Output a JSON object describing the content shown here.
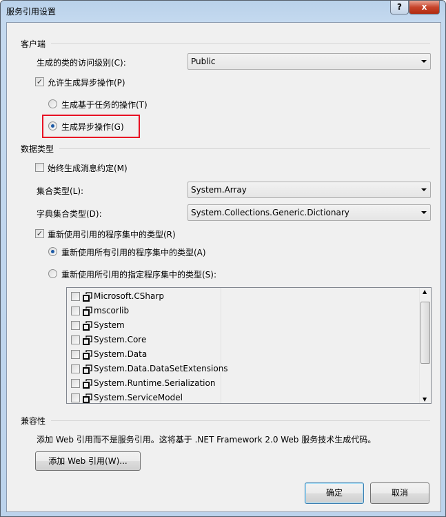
{
  "window": {
    "title": "服务引用设置",
    "help_label": "?",
    "close_label": "x"
  },
  "client": {
    "header": "客户端",
    "access_label": "生成的类的访问级别(C):",
    "access_value": "Public",
    "async_checkbox": {
      "label": "允许生成异步操作(P)",
      "checked": true
    },
    "task_radio": {
      "label": "生成基于任务的操作(T)",
      "selected": false
    },
    "async_radio": {
      "label": "生成异步操作(G)",
      "selected": true
    },
    "highlight_color": "#e81123"
  },
  "data_types": {
    "header": "数据类型",
    "message_contract": {
      "label": "始终生成消息约定(M)",
      "checked": false
    },
    "collection_label": "集合类型(L):",
    "collection_value": "System.Array",
    "dictionary_label": "字典集合类型(D):",
    "dictionary_value": "System.Collections.Generic.Dictionary",
    "reuse_types": {
      "label": "重新使用引用的程序集中的类型(R)",
      "checked": true
    },
    "reuse_all": {
      "label": "重新使用所有引用的程序集中的类型(A)",
      "selected": true
    },
    "reuse_specified": {
      "label": "重新使用所引用的指定程序集中的类型(S):",
      "selected": false
    },
    "assemblies": [
      {
        "name": "Microsoft.CSharp"
      },
      {
        "name": "mscorlib"
      },
      {
        "name": "System"
      },
      {
        "name": "System.Core"
      },
      {
        "name": "System.Data"
      },
      {
        "name": "System.Data.DataSetExtensions"
      },
      {
        "name": "System.Runtime.Serialization"
      },
      {
        "name": "System.ServiceModel"
      }
    ]
  },
  "compat": {
    "header": "兼容性",
    "description": "添加 Web 引用而不是服务引用。这将基于 .NET Framework 2.0 Web 服务技术生成代码。",
    "add_web_ref": "添加 Web 引用(W)..."
  },
  "footer": {
    "ok": "确定",
    "cancel": "取消"
  }
}
